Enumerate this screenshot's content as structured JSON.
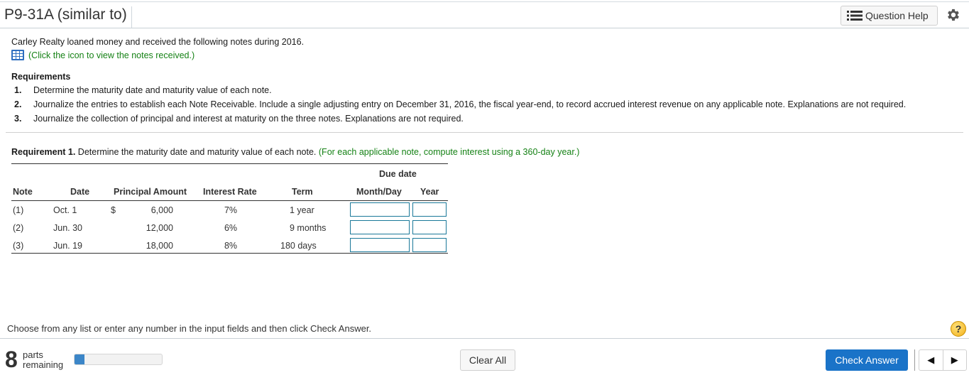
{
  "header": {
    "title": "P9-31A (similar to)",
    "question_help_label": "Question Help",
    "icons": {
      "help_list": "list-icon",
      "settings": "gear-icon"
    }
  },
  "problem": {
    "intro": "Carley Realty loaned money and received the following notes during 2016.",
    "click_note": "(Click the icon to view the notes received.)",
    "click_icon": "table-grid-icon",
    "requirements_title": "Requirements",
    "requirements": [
      {
        "num": "1.",
        "text": "Determine the maturity date and maturity value of each note."
      },
      {
        "num": "2.",
        "text": "Journalize the entries to establish each Note Receivable. Include a single adjusting entry on December 31, 2016, the fiscal year-end, to record accrued interest revenue on any applicable note. Explanations are not required."
      },
      {
        "num": "3.",
        "text": "Journalize the collection of principal and interest at maturity on the three notes. Explanations are not required."
      }
    ]
  },
  "requirement1": {
    "label": "Requirement 1.",
    "text": "Determine the maturity date and maturity value of each note.",
    "hint": "(For each applicable note, compute interest using a 360-day year.)"
  },
  "table": {
    "group_header": "Due date",
    "headers": {
      "note": "Note",
      "date": "Date",
      "principal": "Principal Amount",
      "rate": "Interest Rate",
      "term": "Term",
      "month_day": "Month/Day",
      "year": "Year"
    },
    "rows": [
      {
        "note": "(1)",
        "date": "Oct. 1",
        "currency": "$",
        "principal": "6,000",
        "rate": "7%",
        "term": "1 year",
        "month_day": "",
        "year": ""
      },
      {
        "note": "(2)",
        "date": "Jun. 30",
        "currency": "",
        "principal": "12,000",
        "rate": "6%",
        "term": "9 months",
        "month_day": "",
        "year": ""
      },
      {
        "note": "(3)",
        "date": "Jun. 19",
        "currency": "",
        "principal": "18,000",
        "rate": "8%",
        "term": "180 days",
        "month_day": "",
        "year": ""
      }
    ]
  },
  "footer": {
    "instruction": "Choose from any list or enter any number in the input fields and then click Check Answer.",
    "help_symbol": "?",
    "parts_count": "8",
    "parts_label_1": "parts",
    "parts_label_2": "remaining",
    "progress_fraction": 0.11,
    "clear_all_label": "Clear All",
    "check_answer_label": "Check Answer",
    "prev_symbol": "◀",
    "next_symbol": "▶",
    "colors": {
      "primary": "#1a73c8",
      "progress": "#3c86c8",
      "link_green": "#168216",
      "input_border": "#1a7899"
    }
  }
}
